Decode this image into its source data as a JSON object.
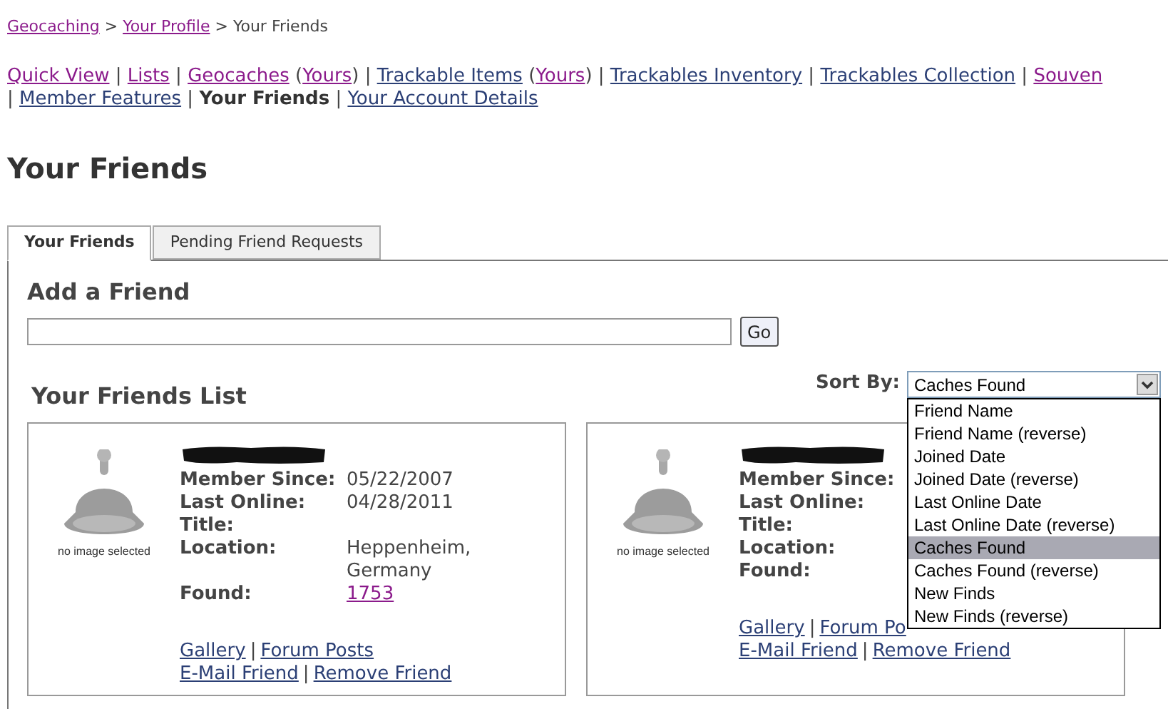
{
  "breadcrumb": [
    {
      "kind": "link",
      "text": "Geocaching",
      "visited": true
    },
    {
      "kind": "text",
      "text": " > "
    },
    {
      "kind": "link",
      "text": "Your Profile",
      "visited": true
    },
    {
      "kind": "text",
      "text": " > "
    },
    {
      "kind": "current",
      "text": "Your Friends"
    }
  ],
  "nav": [
    [
      {
        "kind": "link",
        "text": "Quick View",
        "visited": true
      },
      {
        "kind": "text",
        "text": " | "
      },
      {
        "kind": "link",
        "text": "Lists",
        "visited": true
      },
      {
        "kind": "text",
        "text": " | "
      },
      {
        "kind": "link",
        "text": "Geocaches",
        "visited": true
      },
      {
        "kind": "text",
        "text": " ("
      },
      {
        "kind": "link",
        "text": "Yours",
        "visited": true
      },
      {
        "kind": "text",
        "text": ") | "
      },
      {
        "kind": "link",
        "text": "Trackable Items",
        "visited": false
      },
      {
        "kind": "text",
        "text": " ("
      },
      {
        "kind": "link",
        "text": "Yours",
        "visited": true
      },
      {
        "kind": "text",
        "text": ") | "
      },
      {
        "kind": "link",
        "text": "Trackables Inventory",
        "visited": false
      },
      {
        "kind": "text",
        "text": " | "
      },
      {
        "kind": "link",
        "text": "Trackables Collection",
        "visited": false
      },
      {
        "kind": "text",
        "text": " | "
      },
      {
        "kind": "link",
        "text": "Souven",
        "visited": true
      }
    ],
    [
      {
        "kind": "text",
        "text": "| "
      },
      {
        "kind": "link",
        "text": "Member Features",
        "visited": false
      },
      {
        "kind": "text",
        "text": " | "
      },
      {
        "kind": "current",
        "text": "Your Friends"
      },
      {
        "kind": "text",
        "text": " | "
      },
      {
        "kind": "link",
        "text": "Your Account Details",
        "visited": false
      }
    ]
  ],
  "page_title": "Your Friends",
  "tabs": [
    {
      "label": "Your Friends",
      "selected": true
    },
    {
      "label": "Pending Friend Requests",
      "selected": false
    }
  ],
  "add_friend": {
    "heading": "Add a Friend",
    "button": "Go"
  },
  "friends_list": {
    "heading": "Your Friends List"
  },
  "sort": {
    "label": "Sort By:",
    "value": "Caches Found",
    "expanded": true,
    "options": [
      {
        "label": "Friend Name",
        "selected": false
      },
      {
        "label": "Friend Name (reverse)",
        "selected": false
      },
      {
        "label": "Joined Date",
        "selected": false
      },
      {
        "label": "Joined Date (reverse)",
        "selected": false
      },
      {
        "label": "Last Online Date",
        "selected": false
      },
      {
        "label": "Last Online Date (reverse)",
        "selected": false
      },
      {
        "label": "Caches Found",
        "selected": true
      },
      {
        "label": "Caches Found (reverse)",
        "selected": false
      },
      {
        "label": "New Finds",
        "selected": false
      },
      {
        "label": "New Finds (reverse)",
        "selected": false
      }
    ]
  },
  "friends": [
    {
      "avatar_caption": "no image selected",
      "fields": [
        {
          "label": "Member Since:",
          "value": "05/22/2007"
        },
        {
          "label": "Last Online:",
          "value": "04/28/2011"
        },
        {
          "label": "Title:"
        },
        {
          "label": "Location:",
          "value": "Heppenheim, Germany"
        },
        {
          "label": "Found:",
          "value": "1753",
          "link": true
        }
      ],
      "links": [
        [
          {
            "kind": "link",
            "text": "Gallery"
          },
          {
            "kind": "text",
            "text": "|"
          },
          {
            "kind": "link",
            "text": "Forum Posts"
          }
        ],
        [
          {
            "kind": "link",
            "text": "E-Mail Friend"
          },
          {
            "kind": "text",
            "text": "|"
          },
          {
            "kind": "link",
            "text": "Remove Friend"
          }
        ]
      ]
    },
    {
      "avatar_caption": "no image selected",
      "fields": [
        {
          "label": "Member Since:"
        },
        {
          "label": "Last Online:"
        },
        {
          "label": "Title:"
        },
        {
          "label": "Location:"
        },
        {
          "label": "Found:"
        }
      ],
      "links": [
        [
          {
            "kind": "link",
            "text": "Gallery"
          },
          {
            "kind": "text",
            "text": "|"
          },
          {
            "kind": "link",
            "text": "Forum Po"
          }
        ],
        [
          {
            "kind": "link",
            "text": "E-Mail Friend"
          },
          {
            "kind": "text",
            "text": "|"
          },
          {
            "kind": "link",
            "text": "Remove Friend"
          }
        ]
      ]
    }
  ]
}
